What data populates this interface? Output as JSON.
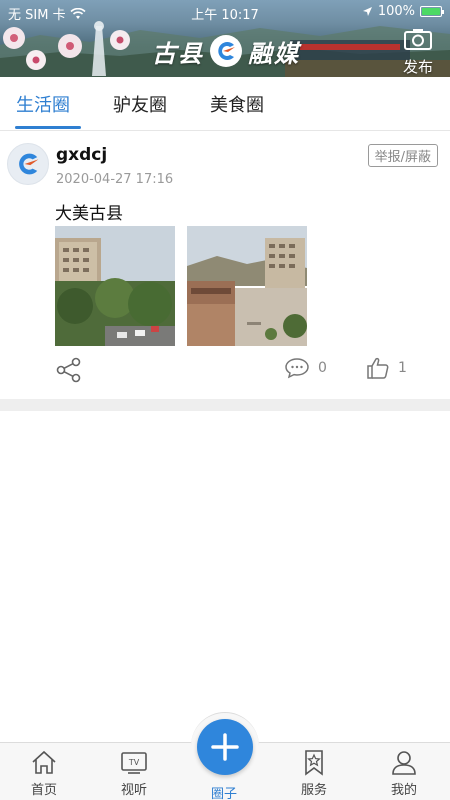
{
  "status_bar": {
    "carrier": "无 SIM 卡",
    "time": "上午 10:17",
    "battery": "100%",
    "wifi_icon": "wifi-icon",
    "location_icon": "location-arrow-icon"
  },
  "header": {
    "title_left": "古县",
    "title_right": "融媒",
    "publish_label": "发布",
    "publish_icon": "camera-icon",
    "accent": "#2f7fd1"
  },
  "tabs": [
    {
      "label": "生活圈",
      "active": true
    },
    {
      "label": "驴友圈",
      "active": false
    },
    {
      "label": "美食圈",
      "active": false
    }
  ],
  "post": {
    "username": "gxdcj",
    "timestamp": "2020-04-27 17:16",
    "report_label": "举报/屏蔽",
    "text": "大美古县",
    "comment_count": "0",
    "like_count": "1",
    "share_icon": "share-icon",
    "comment_icon": "comment-icon",
    "like_icon": "thumbs-up-icon"
  },
  "bottom_nav": [
    {
      "label": "首页",
      "icon": "home-icon",
      "active": false
    },
    {
      "label": "视听",
      "icon": "tv-icon",
      "active": false
    },
    {
      "label": "圈子",
      "icon": "plus-icon",
      "active": true
    },
    {
      "label": "服务",
      "icon": "bookmark-star-icon",
      "active": false
    },
    {
      "label": "我的",
      "icon": "user-icon",
      "active": false
    }
  ]
}
